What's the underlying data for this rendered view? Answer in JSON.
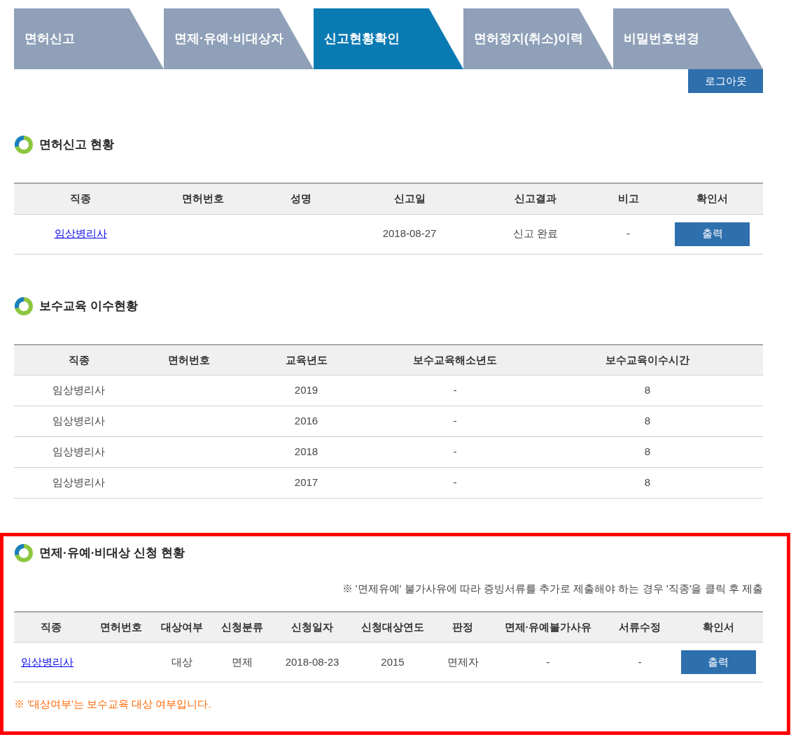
{
  "tabs": [
    {
      "label": "면허신고",
      "selected": false
    },
    {
      "label": "면제·유예·비대상자",
      "selected": false
    },
    {
      "label": "신고현황확인",
      "selected": true
    },
    {
      "label": "면허정지(취소)이력",
      "selected": false
    },
    {
      "label": "비밀번호변경",
      "selected": false
    }
  ],
  "logout_button": "로그아웃",
  "license_report": {
    "title": "면허신고 현황",
    "columns": [
      "직종",
      "면허번호",
      "성명",
      "신고일",
      "신고결과",
      "비고",
      "확인서"
    ],
    "rows": [
      [
        {
          "kind": "link",
          "text": "임상병리사"
        },
        null,
        null,
        "2018-08-27",
        "신고 완료",
        "-",
        {
          "kind": "button",
          "text": "출력"
        }
      ]
    ]
  },
  "continuing_education": {
    "title": "보수교육 이수현황",
    "columns": [
      "직종",
      "면허번호",
      "교육년도",
      "보수교육해소년도",
      "보수교육이수시간"
    ],
    "rows": [
      [
        "임상병리사",
        null,
        "2019",
        "-",
        "8"
      ],
      [
        "임상병리사",
        null,
        "2016",
        "-",
        "8"
      ],
      [
        "임상병리사",
        null,
        "2018",
        "-",
        "8"
      ],
      [
        "임상병리사",
        null,
        "2017",
        "-",
        "8"
      ]
    ]
  },
  "exemption": {
    "title": "면제·유예·비대상 신청 현황",
    "notice": "※ '면제유예' 불가사유에 따라 증빙서류를 추가로 제출해야 하는 경우 '직종'을 클릭 후 제출",
    "columns": [
      "직종",
      "면허번호",
      "대상여부",
      "신청분류",
      "신청일자",
      "신청대상연도",
      "판정",
      "면제·유예불가사유",
      "서류수정",
      "확인서"
    ],
    "rows": [
      [
        {
          "kind": "link",
          "text": "임상병리사"
        },
        null,
        "대상",
        "면제",
        "2018-08-23",
        "2015",
        "면제자",
        "-",
        "-",
        {
          "kind": "button",
          "text": "출력"
        }
      ]
    ],
    "footnote": "※ '대상여부'는 보수교육 대상 여부입니다."
  }
}
